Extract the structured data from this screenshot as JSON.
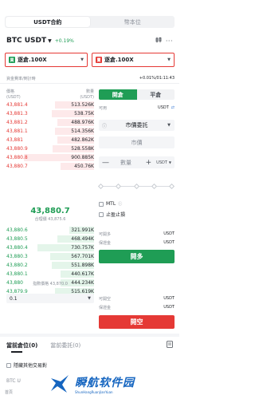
{
  "top_tabs": [
    {
      "label": "USDT合約",
      "active": true
    },
    {
      "label": "幣本位",
      "active": false
    }
  ],
  "pair": {
    "name": "BTC USDT",
    "change": "+0.19%"
  },
  "modes": [
    {
      "tag": "買",
      "label": "逐倉.100X",
      "color": "#1f9d55"
    },
    {
      "tag": "賣",
      "label": "逐倉.100X",
      "color": "#e53935"
    }
  ],
  "funding": {
    "label": "資金費率/倒計時",
    "value": "+0.01%/01:11:43"
  },
  "orderbook": {
    "price_header": "價格\n(USDT)",
    "qty_header": "數量\n(USDT)",
    "asks": [
      {
        "price": "43,881.4",
        "qty": "513.526K",
        "depth": 0.45
      },
      {
        "price": "43,881.3",
        "qty": "538.75K",
        "depth": 0.48
      },
      {
        "price": "43,881.2",
        "qty": "488.976K",
        "depth": 0.42
      },
      {
        "price": "43,881.1",
        "qty": "514.356K",
        "depth": 0.45
      },
      {
        "price": "43,881",
        "qty": "482.862K",
        "depth": 0.42
      },
      {
        "price": "43,880.9",
        "qty": "528.558K",
        "depth": 0.47
      },
      {
        "price": "43,880.8",
        "qty": "900.885K",
        "depth": 0.8
      },
      {
        "price": "43,880.7",
        "qty": "450.76K",
        "depth": 0.38
      }
    ],
    "mid_price": "43,880.7",
    "mid_label": "合理價",
    "mid_value": "43,875.6",
    "bids": [
      {
        "price": "43,880.6",
        "qty": "321.991K",
        "depth": 0.28
      },
      {
        "price": "43,880.5",
        "qty": "468.494K",
        "depth": 0.42
      },
      {
        "price": "43,880.4",
        "qty": "730.757K",
        "depth": 0.65
      },
      {
        "price": "43,880.3",
        "qty": "567.701K",
        "depth": 0.5
      },
      {
        "price": "43,880.2",
        "qty": "551.898K",
        "depth": 0.48
      },
      {
        "price": "43,880.1",
        "qty": "440.617K",
        "depth": 0.38
      },
      {
        "price": "43,880",
        "qty": "444.234K",
        "depth": 0.38
      },
      {
        "price": "43,879.9",
        "qty": "515.619K",
        "depth": 0.45
      }
    ],
    "index_label": "指數價格",
    "index_value": "43,870.0",
    "depth_select": "0.1"
  },
  "trade": {
    "tabs": [
      {
        "label": "開倉",
        "active": true
      },
      {
        "label": "平倉",
        "active": false
      }
    ],
    "available_label": "可用",
    "available_unit": "USDT",
    "order_type": "市價委託",
    "price_placeholder": "市價",
    "amount_minus": "—",
    "amount_placeholder": "數量",
    "amount_plus": "+",
    "amount_unit": "USDT",
    "mtl_label": "MTL",
    "stop_label": "止盈止損",
    "open_long_label": "可開多",
    "open_long_unit": "USDT",
    "margin_label": "保證金",
    "margin_unit": "USDT",
    "long_button": "開多",
    "open_short_label": "可開空",
    "open_short_unit": "USDT",
    "margin2_label": "保證金",
    "margin2_unit": "USDT",
    "short_button": "開空"
  },
  "bottom": {
    "tabs": [
      {
        "label": "當前倉位(0)",
        "active": true
      },
      {
        "label": "當前委託(0)",
        "active": false
      }
    ],
    "hide_label": "隱藏其他交易對",
    "position_pair": "BTC U",
    "nav_label": "首頁"
  },
  "watermark": {
    "cn": "瞬航软件园",
    "en": "ShunHangRuanJianYuan"
  },
  "colors": {
    "up": "#1f9d55",
    "down": "#e53935",
    "link": "#3a7bd5"
  }
}
